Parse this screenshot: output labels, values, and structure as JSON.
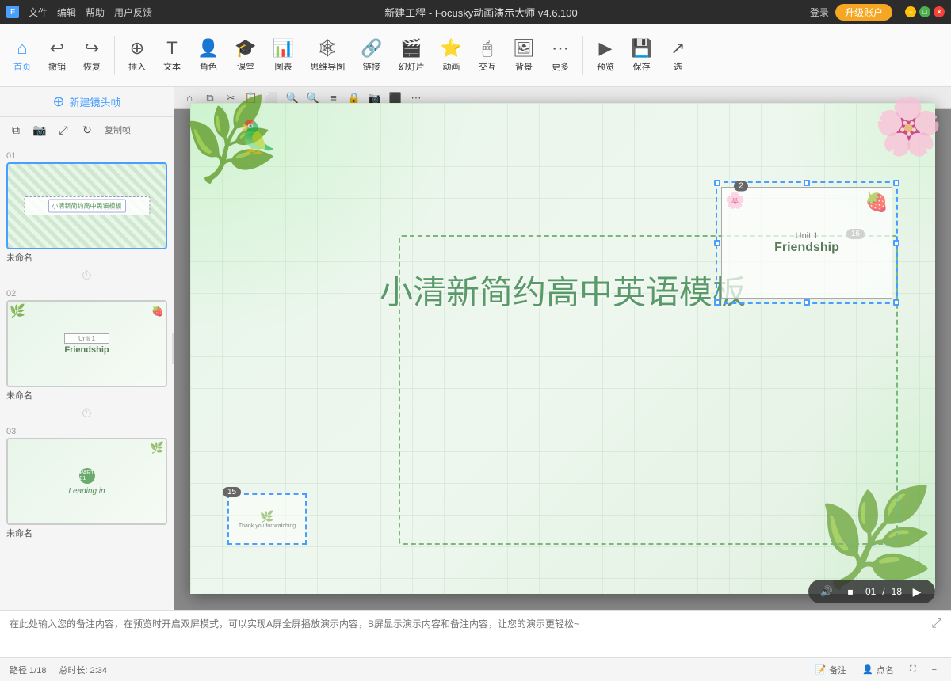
{
  "titleBar": {
    "appName": "Focusky动画演示大师",
    "version": "v4.6.100",
    "projectName": "新建工程",
    "fullTitle": "新建工程 - Focusky动画演示大师 v4.6.100",
    "menuItems": [
      "文件",
      "编辑",
      "帮助",
      "用户反馈"
    ],
    "loginLabel": "登录",
    "upgradeLabel": "升级账户"
  },
  "toolbar": {
    "homeLabel": "首页",
    "undoLabel": "撤销",
    "redoLabel": "恢复",
    "insertLabel": "插入",
    "textLabel": "文本",
    "roleLabel": "角色",
    "classroomLabel": "课堂",
    "chartLabel": "图表",
    "mindmapLabel": "思维导图",
    "linkLabel": "链接",
    "slideshowLabel": "幻灯片",
    "animationLabel": "动画",
    "interactLabel": "交互",
    "backgroundLabel": "背景",
    "moreLabel": "更多",
    "previewLabel": "预览",
    "saveLabel": "保存",
    "selectLabel": "选"
  },
  "sidebar": {
    "newFrameLabel": "新建镜头帧",
    "copyFrameLabel": "复制帧",
    "slides": [
      {
        "number": "01",
        "label": "未命名",
        "type": "pattern"
      },
      {
        "number": "02",
        "label": "未命名",
        "type": "friendship"
      },
      {
        "number": "03",
        "label": "未命名",
        "type": "leading"
      }
    ]
  },
  "canvas": {
    "mainTitle": "小清新简约高中英语模板",
    "frame2Label": "2",
    "frame16Label": "16",
    "frame15Label": "15",
    "selectedUnit": "Unit 1",
    "selectedTitle": "Friendship",
    "smallFrameText": "Thank you for watching"
  },
  "playback": {
    "current": "01",
    "total": "18",
    "separator": "/"
  },
  "notes": {
    "placeholder": "在此处输入您的备注内容，在预览时开启双屏模式，可以实现A屏全屏播放演示内容，B屏显示演示内容和备注内容，让您的演示更轻松~"
  },
  "statusBar": {
    "path": "路径 1/18",
    "duration": "总时长: 2:34",
    "notesLabel": "备注",
    "markerLabel": "点名"
  }
}
